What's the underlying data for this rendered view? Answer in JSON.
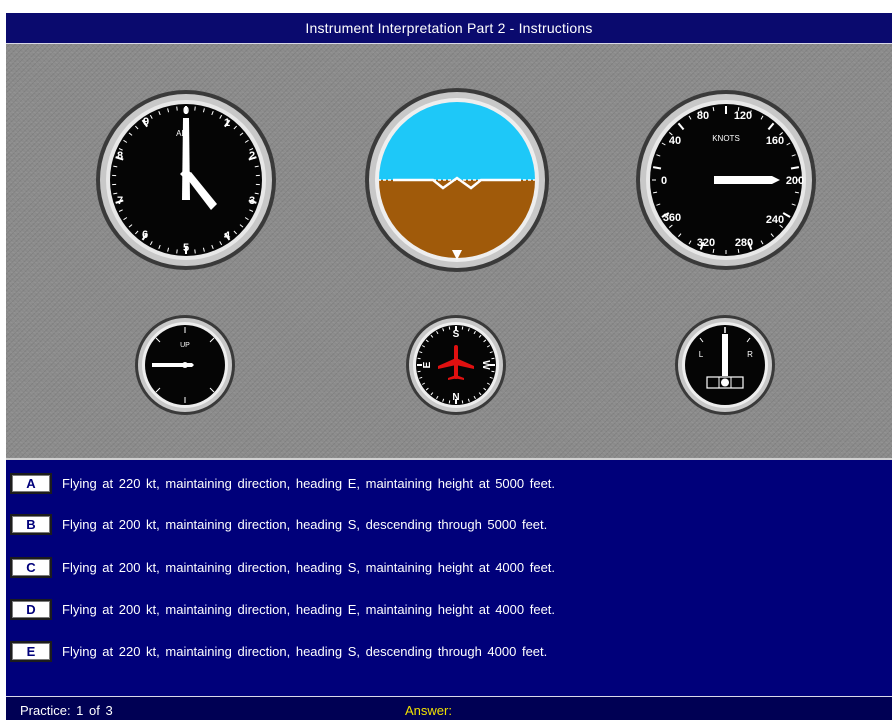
{
  "window": {
    "title": "Instrument Interpretation Part 2 - Instructions"
  },
  "instruments": {
    "altimeter": {
      "label": "AL",
      "numerals": [
        "0",
        "1",
        "2",
        "3",
        "4",
        "5",
        "6",
        "7",
        "8",
        "9"
      ],
      "icon": "altimeter-icon"
    },
    "attitude_indicator": {
      "icon": "attitude-indicator-icon",
      "sky_color": "#1ec8f8",
      "ground_color": "#a05a0a"
    },
    "airspeed": {
      "unit": "KNOTS",
      "labels": [
        "80",
        "120",
        "160",
        "200",
        "240",
        "280",
        "320",
        "360",
        "0",
        "40"
      ],
      "icon": "airspeed-indicator-icon"
    },
    "vertical_speed": {
      "label": "UP",
      "icon": "vertical-speed-icon"
    },
    "compass": {
      "labels": [
        "S",
        "W",
        "N",
        "E"
      ],
      "icon": "compass-icon",
      "aircraft_color": "#e01010"
    },
    "turn_indicator": {
      "left_label": "L",
      "right_label": "R",
      "icon": "turn-indicator-icon"
    }
  },
  "answers": [
    {
      "key": "A",
      "text": "Flying at 220 kt, maintaining direction, heading E, maintaining height at 5000 feet."
    },
    {
      "key": "B",
      "text": "Flying at 200 kt, maintaining direction, heading S, descending through 5000 feet."
    },
    {
      "key": "C",
      "text": "Flying at 200 kt, maintaining direction, heading S, maintaining height at 4000 feet."
    },
    {
      "key": "D",
      "text": "Flying at 200 kt, maintaining direction, heading E, maintaining height at 4000 feet."
    },
    {
      "key": "E",
      "text": "Flying at 220 kt, maintaining direction, heading S, descending through 4000 feet."
    }
  ],
  "status": {
    "practice": "Practice: 1 of 3",
    "answer_label": "Answer:"
  },
  "colors": {
    "title_bg": "#0a0a6e",
    "answers_bg": "#00007a",
    "status_bg": "#000054",
    "answer_label": "#f0e000"
  }
}
